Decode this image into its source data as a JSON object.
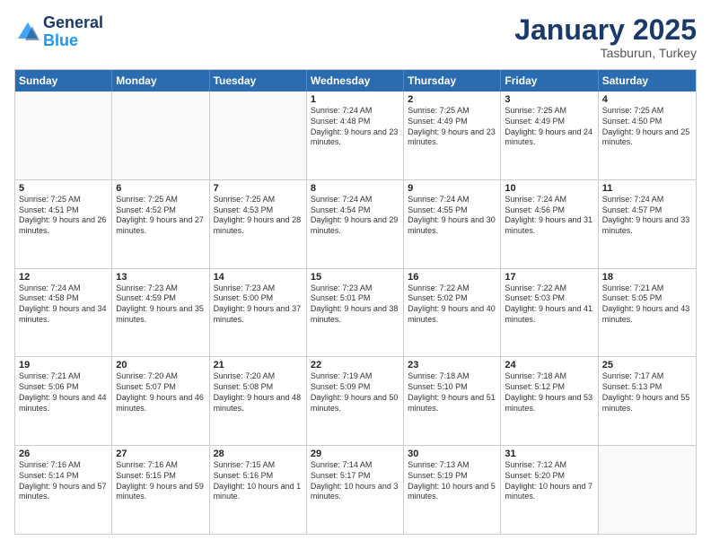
{
  "header": {
    "logo_line1": "General",
    "logo_line2": "Blue",
    "month": "January 2025",
    "location": "Tasburun, Turkey"
  },
  "days_of_week": [
    "Sunday",
    "Monday",
    "Tuesday",
    "Wednesday",
    "Thursday",
    "Friday",
    "Saturday"
  ],
  "weeks": [
    [
      {
        "day": "",
        "info": ""
      },
      {
        "day": "",
        "info": ""
      },
      {
        "day": "",
        "info": ""
      },
      {
        "day": "1",
        "info": "Sunrise: 7:24 AM\nSunset: 4:48 PM\nDaylight: 9 hours and 23 minutes."
      },
      {
        "day": "2",
        "info": "Sunrise: 7:25 AM\nSunset: 4:49 PM\nDaylight: 9 hours and 23 minutes."
      },
      {
        "day": "3",
        "info": "Sunrise: 7:25 AM\nSunset: 4:49 PM\nDaylight: 9 hours and 24 minutes."
      },
      {
        "day": "4",
        "info": "Sunrise: 7:25 AM\nSunset: 4:50 PM\nDaylight: 9 hours and 25 minutes."
      }
    ],
    [
      {
        "day": "5",
        "info": "Sunrise: 7:25 AM\nSunset: 4:51 PM\nDaylight: 9 hours and 26 minutes."
      },
      {
        "day": "6",
        "info": "Sunrise: 7:25 AM\nSunset: 4:52 PM\nDaylight: 9 hours and 27 minutes."
      },
      {
        "day": "7",
        "info": "Sunrise: 7:25 AM\nSunset: 4:53 PM\nDaylight: 9 hours and 28 minutes."
      },
      {
        "day": "8",
        "info": "Sunrise: 7:24 AM\nSunset: 4:54 PM\nDaylight: 9 hours and 29 minutes."
      },
      {
        "day": "9",
        "info": "Sunrise: 7:24 AM\nSunset: 4:55 PM\nDaylight: 9 hours and 30 minutes."
      },
      {
        "day": "10",
        "info": "Sunrise: 7:24 AM\nSunset: 4:56 PM\nDaylight: 9 hours and 31 minutes."
      },
      {
        "day": "11",
        "info": "Sunrise: 7:24 AM\nSunset: 4:57 PM\nDaylight: 9 hours and 33 minutes."
      }
    ],
    [
      {
        "day": "12",
        "info": "Sunrise: 7:24 AM\nSunset: 4:58 PM\nDaylight: 9 hours and 34 minutes."
      },
      {
        "day": "13",
        "info": "Sunrise: 7:23 AM\nSunset: 4:59 PM\nDaylight: 9 hours and 35 minutes."
      },
      {
        "day": "14",
        "info": "Sunrise: 7:23 AM\nSunset: 5:00 PM\nDaylight: 9 hours and 37 minutes."
      },
      {
        "day": "15",
        "info": "Sunrise: 7:23 AM\nSunset: 5:01 PM\nDaylight: 9 hours and 38 minutes."
      },
      {
        "day": "16",
        "info": "Sunrise: 7:22 AM\nSunset: 5:02 PM\nDaylight: 9 hours and 40 minutes."
      },
      {
        "day": "17",
        "info": "Sunrise: 7:22 AM\nSunset: 5:03 PM\nDaylight: 9 hours and 41 minutes."
      },
      {
        "day": "18",
        "info": "Sunrise: 7:21 AM\nSunset: 5:05 PM\nDaylight: 9 hours and 43 minutes."
      }
    ],
    [
      {
        "day": "19",
        "info": "Sunrise: 7:21 AM\nSunset: 5:06 PM\nDaylight: 9 hours and 44 minutes."
      },
      {
        "day": "20",
        "info": "Sunrise: 7:20 AM\nSunset: 5:07 PM\nDaylight: 9 hours and 46 minutes."
      },
      {
        "day": "21",
        "info": "Sunrise: 7:20 AM\nSunset: 5:08 PM\nDaylight: 9 hours and 48 minutes."
      },
      {
        "day": "22",
        "info": "Sunrise: 7:19 AM\nSunset: 5:09 PM\nDaylight: 9 hours and 50 minutes."
      },
      {
        "day": "23",
        "info": "Sunrise: 7:18 AM\nSunset: 5:10 PM\nDaylight: 9 hours and 51 minutes."
      },
      {
        "day": "24",
        "info": "Sunrise: 7:18 AM\nSunset: 5:12 PM\nDaylight: 9 hours and 53 minutes."
      },
      {
        "day": "25",
        "info": "Sunrise: 7:17 AM\nSunset: 5:13 PM\nDaylight: 9 hours and 55 minutes."
      }
    ],
    [
      {
        "day": "26",
        "info": "Sunrise: 7:16 AM\nSunset: 5:14 PM\nDaylight: 9 hours and 57 minutes."
      },
      {
        "day": "27",
        "info": "Sunrise: 7:16 AM\nSunset: 5:15 PM\nDaylight: 9 hours and 59 minutes."
      },
      {
        "day": "28",
        "info": "Sunrise: 7:15 AM\nSunset: 5:16 PM\nDaylight: 10 hours and 1 minute."
      },
      {
        "day": "29",
        "info": "Sunrise: 7:14 AM\nSunset: 5:17 PM\nDaylight: 10 hours and 3 minutes."
      },
      {
        "day": "30",
        "info": "Sunrise: 7:13 AM\nSunset: 5:19 PM\nDaylight: 10 hours and 5 minutes."
      },
      {
        "day": "31",
        "info": "Sunrise: 7:12 AM\nSunset: 5:20 PM\nDaylight: 10 hours and 7 minutes."
      },
      {
        "day": "",
        "info": ""
      }
    ]
  ]
}
